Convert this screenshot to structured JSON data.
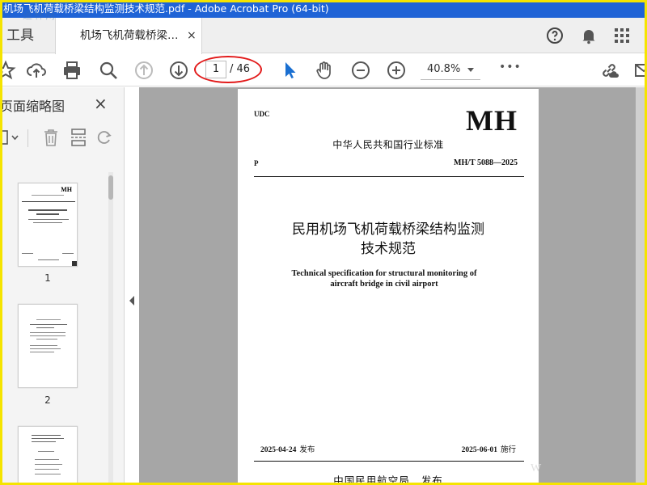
{
  "window": {
    "title": "机场飞机荷载桥梁结构监测技术规范.pdf - Adobe Acrobat Pro (64-bit)"
  },
  "watermark": {
    "top_left": "道林网",
    "bottom_right": "W"
  },
  "tabs": {
    "tools_label": "工具",
    "document_label": "机场飞机荷载桥梁…",
    "close_glyph": "×"
  },
  "toolbar": {
    "current_page": "1",
    "total_pages": "/ 46",
    "zoom": "40.8%",
    "more_glyph": "•••"
  },
  "thumbnails_panel": {
    "title": "页面缩略图",
    "close_glyph": "×",
    "pages": [
      {
        "number": "1"
      },
      {
        "number": "2"
      }
    ]
  },
  "document": {
    "udc": "UDC",
    "brand": "MH",
    "standard_type": "中华人民共和国行业标准",
    "classification": "P",
    "standard_number": "MH/T 5088—2025",
    "title_cn_line1": "民用机场飞机荷载桥梁结构监测",
    "title_cn_line2": "技术规范",
    "title_en_line1": "Technical specification for structural monitoring of",
    "title_en_line2": "aircraft bridge in civil airport",
    "issue_date": "2025-04-24",
    "issue_label": "发布",
    "implement_date": "2025-06-01",
    "implement_label": "施行",
    "publisher": "中国民用航空局",
    "publisher_action": "发布"
  },
  "colors": {
    "titlebar": "#1f63d6",
    "frame": "#f5e400",
    "annotation": "#e21a1a",
    "select_tool": "#1a6fd1"
  }
}
